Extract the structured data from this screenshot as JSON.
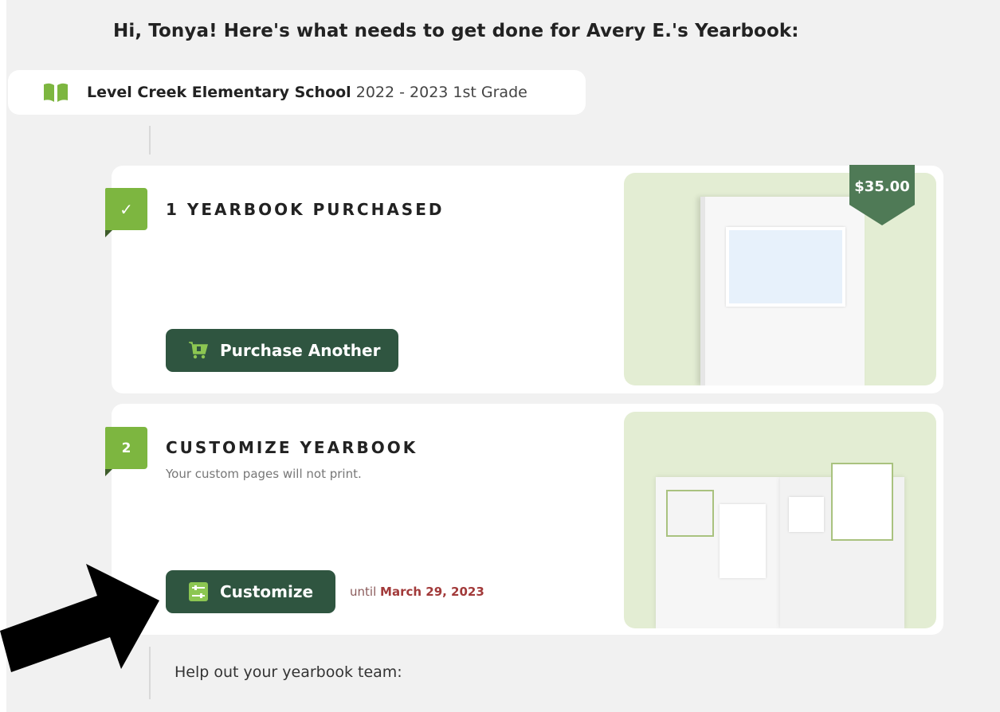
{
  "header": {
    "greeting": "Hi, Tonya! Here's what needs to get done for Avery E.'s Yearbook:"
  },
  "school": {
    "name": "Level Creek Elementary School",
    "details": "2022 - 2023 1st Grade",
    "icon": "book-icon"
  },
  "steps": [
    {
      "badge": "✓",
      "title": "1 YEARBOOK PURCHASED",
      "button_label": "Purchase Another",
      "button_icon": "cart-icon",
      "price": "$35.00"
    },
    {
      "badge": "2",
      "title": "CUSTOMIZE YEARBOOK",
      "subtitle": "Your custom pages will not print.",
      "button_label": "Customize",
      "button_icon": "sliders-icon",
      "deadline_prefix": "until",
      "deadline_date": "March 29, 2023"
    }
  ],
  "footer": {
    "help_text": "Help out your yearbook team:"
  },
  "colors": {
    "primary": "#2f5540",
    "accent": "#7db640",
    "panel": "#e3edd3",
    "tag": "#4f7a56",
    "deadline": "#a23a3a"
  }
}
